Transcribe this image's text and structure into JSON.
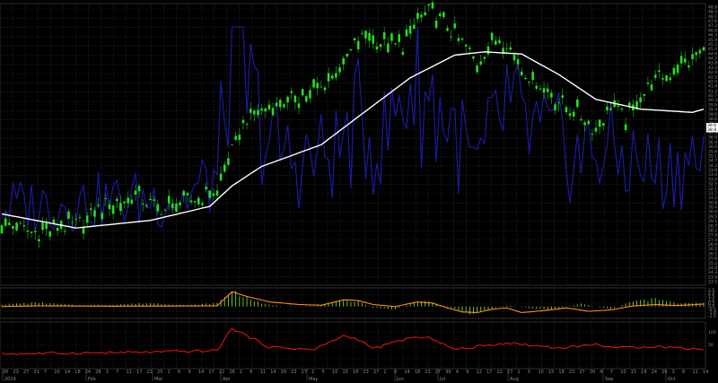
{
  "colors": {
    "background": "#000000",
    "grid": "#2b2b2b",
    "candle_up": "#22e01e",
    "candle_wick": "#18a818",
    "volume": "#1c1ca8",
    "moving_average": "#ffffff",
    "histogram": "#7ed321",
    "signal": "#ff8c1a",
    "bottom_line": "#e01010",
    "axis_text": "#8c8c8c",
    "price_tag_bg": "#ffffff"
  },
  "month_labels": [
    "2014",
    "Feb",
    "Mar",
    "Apr",
    "May",
    "Jun",
    "Jul",
    "Aug",
    "Sep",
    "Oct"
  ],
  "day_labels": [
    "20",
    "23",
    "27",
    "31",
    "7",
    "10",
    "14",
    "18",
    "24",
    "28",
    "3",
    "7",
    "11",
    "17",
    "21",
    "25",
    "1",
    "6",
    "9",
    "14",
    "17",
    "22",
    "28",
    "2",
    "6",
    "11",
    "14",
    "19",
    "23",
    "27",
    "2",
    "5",
    "10",
    "15",
    "18",
    "23",
    "27",
    "1",
    "8",
    "14",
    "18",
    "23",
    "27",
    "30",
    "4",
    "9",
    "12",
    "17",
    "22",
    "27",
    "1",
    "5",
    "10",
    "15",
    "18",
    "23",
    "27",
    "30",
    "4",
    "7",
    "10",
    "15",
    "19",
    "24",
    "29",
    "3",
    "8",
    "11",
    "14"
  ],
  "right_axis_main": [
    "48.9",
    "48.5",
    "48.1",
    "47.6",
    "47.2",
    "46.8",
    "46.3",
    "45.9",
    "45.5",
    "45.0",
    "44.6",
    "44.2",
    "43.8",
    "43.3",
    "42.9",
    "42.5",
    "42.0",
    "41.6",
    "41.2",
    "40.7",
    "40.3",
    "39.9",
    "39.4",
    "39.0",
    "38.6",
    "38.1",
    "37.7",
    "37.3",
    "36.9",
    "36.4",
    "36.0",
    "35.6",
    "35.1",
    "34.7",
    "34.3",
    "33.8",
    "33.4",
    "33.0",
    "32.5",
    "32.1",
    "31.7",
    "31.2",
    "30.8",
    "30.4",
    "30.0",
    "29.5",
    "29.1",
    "28.7",
    "28.2",
    "27.8",
    "27.4",
    "26.9",
    "26.5",
    "26.1",
    "25.6",
    "25.2",
    "24.8",
    "24.3",
    "23.9",
    "23.5"
  ],
  "right_axis_mid": [
    "2.5",
    "2.0",
    "1.5",
    "1.0",
    "0.5",
    "0.0",
    "-0.5",
    "-1.0",
    "-1.5"
  ],
  "right_axis_bottom": [
    "100",
    "50"
  ],
  "price_tags": [
    "39.6",
    "38.8"
  ],
  "chart_data": {
    "type": "line",
    "panels": [
      {
        "name": "price",
        "series": [
          {
            "kind": "candlestick",
            "points": 190
          },
          {
            "kind": "bar",
            "role": "volume"
          },
          {
            "kind": "line",
            "role": "moving-average"
          }
        ]
      },
      {
        "name": "oscillator",
        "series": [
          {
            "kind": "bar",
            "role": "histogram"
          },
          {
            "kind": "line",
            "role": "signal"
          }
        ],
        "ylim": [
          -1.5,
          2.5
        ]
      },
      {
        "name": "lower-indicator",
        "series": [
          {
            "kind": "line",
            "role": "indicator"
          }
        ],
        "ylim": [
          0,
          100
        ]
      }
    ],
    "close_anchors": [
      [
        0,
        29.0
      ],
      [
        8,
        27.8
      ],
      [
        20,
        28.6
      ],
      [
        28,
        30.4
      ],
      [
        36,
        31.2
      ],
      [
        44,
        30.0
      ],
      [
        52,
        31.0
      ],
      [
        58,
        31.6
      ],
      [
        62,
        35.4
      ],
      [
        66,
        38.5
      ],
      [
        72,
        39.3
      ],
      [
        80,
        40.4
      ],
      [
        86,
        41.2
      ],
      [
        92,
        43.4
      ],
      [
        96,
        45.8
      ],
      [
        100,
        46.0
      ],
      [
        104,
        45.0
      ],
      [
        108,
        45.2
      ],
      [
        112,
        47.6
      ],
      [
        116,
        48.6
      ],
      [
        120,
        46.8
      ],
      [
        124,
        45.4
      ],
      [
        128,
        43.6
      ],
      [
        132,
        45.8
      ],
      [
        136,
        45.6
      ],
      [
        140,
        43.0
      ],
      [
        144,
        41.8
      ],
      [
        150,
        40.0
      ],
      [
        156,
        38.6
      ],
      [
        160,
        37.2
      ],
      [
        164,
        39.8
      ],
      [
        168,
        38.4
      ],
      [
        172,
        40.4
      ],
      [
        176,
        42.0
      ],
      [
        180,
        42.6
      ],
      [
        184,
        43.4
      ],
      [
        188,
        44.6
      ],
      [
        190,
        44.2
      ]
    ],
    "ma_anchors": [
      [
        0,
        29.6
      ],
      [
        20,
        28.3
      ],
      [
        40,
        29.0
      ],
      [
        56,
        30.3
      ],
      [
        62,
        32.2
      ],
      [
        70,
        34.0
      ],
      [
        86,
        36.0
      ],
      [
        96,
        38.6
      ],
      [
        110,
        42.2
      ],
      [
        122,
        44.3
      ],
      [
        130,
        44.6
      ],
      [
        140,
        44.4
      ],
      [
        150,
        42.5
      ],
      [
        160,
        40.2
      ],
      [
        172,
        39.3
      ],
      [
        186,
        39.0
      ],
      [
        190,
        39.4
      ]
    ],
    "volume_anchors": [
      [
        0,
        26
      ],
      [
        30,
        28
      ],
      [
        50,
        30
      ],
      [
        58,
        38
      ],
      [
        62,
        100
      ],
      [
        66,
        75
      ],
      [
        72,
        52
      ],
      [
        80,
        44
      ],
      [
        90,
        48
      ],
      [
        96,
        60
      ],
      [
        102,
        50
      ],
      [
        110,
        78
      ],
      [
        114,
        72
      ],
      [
        120,
        62
      ],
      [
        128,
        40
      ],
      [
        136,
        68
      ],
      [
        140,
        58
      ],
      [
        148,
        52
      ],
      [
        156,
        46
      ],
      [
        160,
        50
      ],
      [
        170,
        44
      ],
      [
        178,
        40
      ],
      [
        190,
        48
      ]
    ],
    "hist_anchors": [
      [
        0,
        0.3
      ],
      [
        10,
        0.6
      ],
      [
        20,
        0.2
      ],
      [
        30,
        0.3
      ],
      [
        40,
        0.5
      ],
      [
        50,
        0.2
      ],
      [
        58,
        0.5
      ],
      [
        62,
        2.4
      ],
      [
        66,
        1.3
      ],
      [
        70,
        0.4
      ],
      [
        78,
        -0.1
      ],
      [
        86,
        0.2
      ],
      [
        92,
        0.9
      ],
      [
        96,
        0.8
      ],
      [
        100,
        -0.2
      ],
      [
        106,
        -0.4
      ],
      [
        112,
        0.8
      ],
      [
        116,
        0.6
      ],
      [
        122,
        -0.4
      ],
      [
        126,
        -1.1
      ],
      [
        130,
        -0.6
      ],
      [
        136,
        0.2
      ],
      [
        142,
        -0.2
      ],
      [
        148,
        -0.5
      ],
      [
        156,
        0.4
      ],
      [
        164,
        -0.4
      ],
      [
        170,
        0.8
      ],
      [
        176,
        1.1
      ],
      [
        182,
        0.5
      ],
      [
        190,
        0.6
      ]
    ],
    "signal_anchors": [
      [
        0,
        0.0
      ],
      [
        10,
        0.1
      ],
      [
        30,
        0.05
      ],
      [
        58,
        0.1
      ],
      [
        62,
        2.2
      ],
      [
        66,
        1.5
      ],
      [
        72,
        0.7
      ],
      [
        80,
        0.3
      ],
      [
        86,
        0.2
      ],
      [
        92,
        1.0
      ],
      [
        96,
        0.9
      ],
      [
        100,
        0.3
      ],
      [
        106,
        0.0
      ],
      [
        112,
        0.7
      ],
      [
        116,
        0.5
      ],
      [
        120,
        -0.2
      ],
      [
        124,
        -0.8
      ],
      [
        128,
        -0.9
      ],
      [
        132,
        -0.4
      ],
      [
        136,
        -0.2
      ],
      [
        140,
        -0.9
      ],
      [
        146,
        -0.6
      ],
      [
        152,
        -0.2
      ],
      [
        158,
        -0.7
      ],
      [
        164,
        -0.5
      ],
      [
        170,
        0.1
      ],
      [
        176,
        0.3
      ],
      [
        182,
        0.15
      ],
      [
        190,
        0.4
      ]
    ],
    "bottom_anchors": [
      [
        0,
        30
      ],
      [
        20,
        32
      ],
      [
        40,
        34
      ],
      [
        58,
        38
      ],
      [
        62,
        90
      ],
      [
        66,
        72
      ],
      [
        72,
        46
      ],
      [
        84,
        40
      ],
      [
        92,
        72
      ],
      [
        96,
        64
      ],
      [
        100,
        42
      ],
      [
        110,
        68
      ],
      [
        116,
        66
      ],
      [
        122,
        40
      ],
      [
        136,
        56
      ],
      [
        150,
        44
      ],
      [
        160,
        52
      ],
      [
        166,
        44
      ],
      [
        176,
        48
      ],
      [
        190,
        40
      ]
    ]
  }
}
